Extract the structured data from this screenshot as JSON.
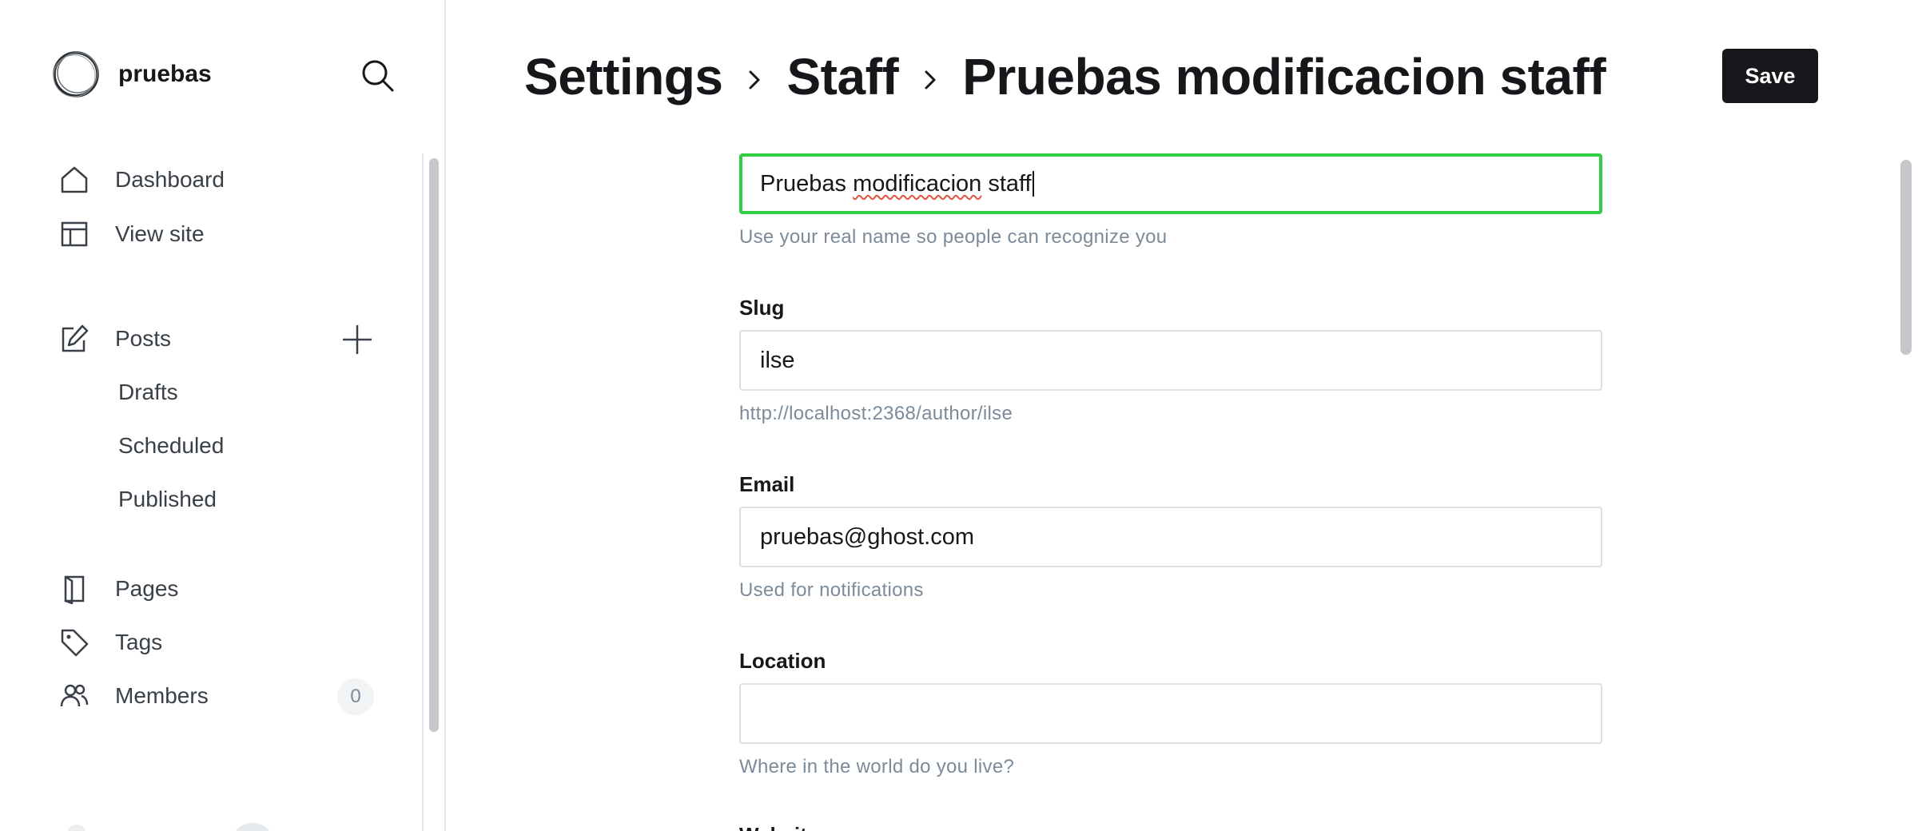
{
  "sidebar": {
    "brand_name": "pruebas",
    "nav": {
      "dashboard": "Dashboard",
      "view_site": "View site",
      "posts": "Posts",
      "drafts": "Drafts",
      "scheduled": "Scheduled",
      "published": "Published",
      "pages": "Pages",
      "tags": "Tags",
      "members": "Members",
      "members_count": "0"
    },
    "icons": [
      "search-icon",
      "home-icon",
      "layout-icon",
      "edit-icon",
      "plus-icon",
      "page-icon",
      "tag-icon",
      "members-icon"
    ]
  },
  "header": {
    "breadcrumb": [
      "Settings",
      "Staff",
      "Pruebas modificacion staff"
    ],
    "save_label": "Save"
  },
  "form": {
    "name": {
      "value_plain": "Pruebas ",
      "value_misspelled": "modificacion",
      "value_rest": " staff",
      "hint": "Use your real name so people can recognize you"
    },
    "slug": {
      "label": "Slug",
      "value": "ilse",
      "hint": "http://localhost:2368/author/ilse"
    },
    "email": {
      "label": "Email",
      "value": "pruebas@ghost.com",
      "hint": "Used for notifications"
    },
    "location": {
      "label": "Location",
      "value": "",
      "hint": "Where in the world do you live?"
    },
    "next_label": "Website"
  },
  "colors": {
    "accent_focus": "#30cf43",
    "primary_button": "#15171a",
    "hint_text": "#7c8b9a",
    "border": "#dce0e3"
  }
}
